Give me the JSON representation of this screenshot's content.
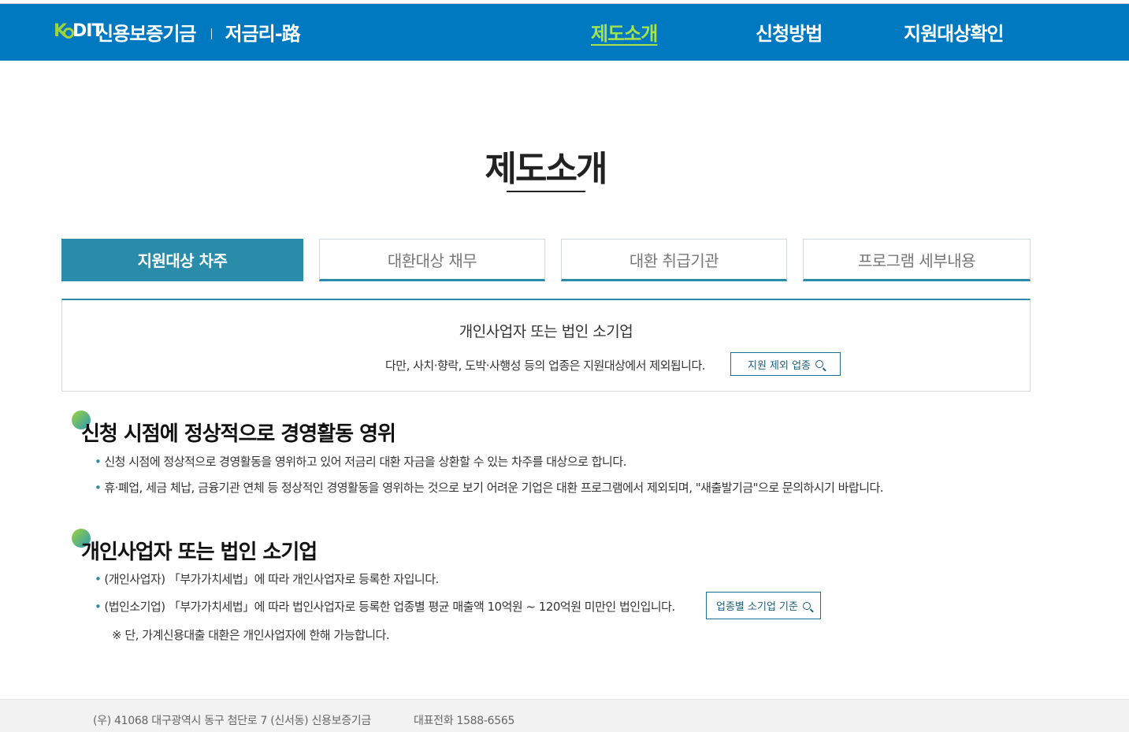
{
  "header": {
    "logo_mark_k": "K",
    "logo_mark_dit": "DIT",
    "logo_org": "신용보증기금",
    "logo_service": "저금리-路",
    "nav": [
      "제도소개",
      "신청방법",
      "지원대상확인"
    ],
    "active_nav": "제도소개"
  },
  "page_title": "제도소개",
  "tabs": [
    "지원대상 차주",
    "대환대상 채무",
    "대환 취급기관",
    "프로그램 세부내용"
  ],
  "active_tab": "지원대상 차주",
  "infobox": {
    "main": "개인사업자 또는 법인 소기업",
    "note": "다만, 사치·향락, 도박·사행성 등의 업종은 지원대상에서 제외됩니다.",
    "button_label": "지원 제외 업종",
    "button_icon": "search-icon"
  },
  "sections": [
    {
      "title": "신청 시점에 정상적으로 경영활동 영위",
      "bullets": [
        "신청 시점에 정상적으로 경영활동을 영위하고 있어 저금리 대환 자금을 상환할 수 있는 차주를 대상으로 합니다.",
        "휴·폐업, 세금 체납, 금융기관 연체 등 정상적인 경영활동을 영위하는 것으로 보기 어려운 기업은 대환 프로그램에서 제외되며, \"새출발기금\"으로 문의하시기 바랍니다."
      ]
    },
    {
      "title": "개인사업자 또는 법인 소기업",
      "bullets": [
        "(개인사업자) 「부가가치세법」에 따라 개인사업자로 등록한 자입니다.",
        "(법인소기업) 「부가가치세법」에 따라 법인사업자로 등록한 업종별 평균 매출액 10억원 ~ 120억원 미만인 법인입니다."
      ],
      "note": "※ 단, 가계신용대출 대환은 개인사업자에 한해 가능합니다.",
      "button_label": "업종별 소기업 기준",
      "button_icon": "search-icon"
    }
  ],
  "footer": {
    "address": "(우) 41068 대구광역시 동구 첨단로 7 (신서동) 신용보증기금",
    "phone": "대표전화 1588-6565"
  },
  "colors": {
    "header_bg": "#0079c1",
    "accent_green": "#a7e24a",
    "tab_active": "#2a8ca8"
  }
}
